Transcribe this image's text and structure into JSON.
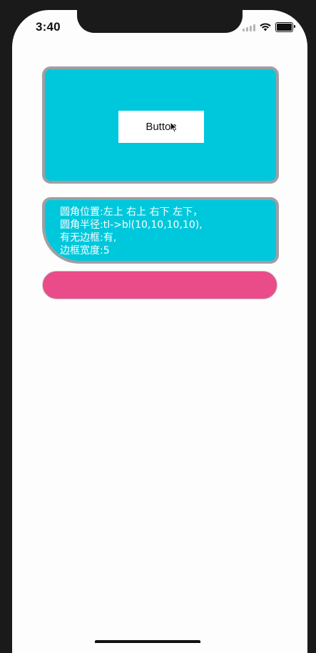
{
  "status_bar": {
    "time": "3:40",
    "icons": [
      "signal-icon",
      "wifi-icon",
      "battery-icon"
    ]
  },
  "top_card": {
    "button_label": "Button",
    "background": "#00c8dc",
    "border_color": "#9e9fa3"
  },
  "mid_card": {
    "lines": [
      "圆角位置:左上 右上 右下 左下，",
      "圆角半径:tl->bl(10,10,10,10),",
      "有无边框:有,",
      "边框宽度:5"
    ],
    "background": "#00c8dc"
  },
  "pill_button": {
    "color": "#ea4c89"
  }
}
